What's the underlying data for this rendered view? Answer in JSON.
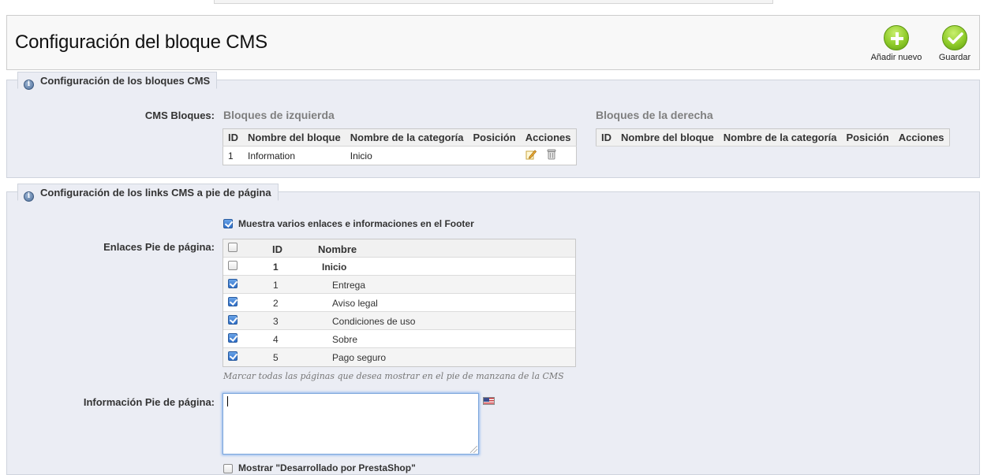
{
  "toolbar": {
    "title": "Configuración del bloque CMS",
    "add_label": "Añadir nuevo",
    "save_label": "Guardar",
    "accent": "#8fcb2a"
  },
  "cms_blocks": {
    "legend": "Configuración de los bloques CMS",
    "label": "CMS Bloques:",
    "left": {
      "heading": "Bloques de izquierda",
      "columns": [
        "ID",
        "Nombre del bloque",
        "Nombre de la categoría",
        "Posición",
        "Acciones"
      ],
      "rows": [
        {
          "id": "1",
          "name": "Information",
          "category": "Inicio",
          "position": ""
        }
      ]
    },
    "right": {
      "heading": "Bloques de la derecha",
      "columns": [
        "ID",
        "Nombre del bloque",
        "Nombre de la categoría",
        "Posición",
        "Acciones"
      ],
      "rows": []
    }
  },
  "footer": {
    "legend": "Configuración de los links CMS a pie de página",
    "show_footer_label": "Muestra varios enlaces e informaciones en el Footer",
    "show_footer_checked": true,
    "links_label": "Enlaces Pie de página:",
    "links_columns": [
      "ID",
      "Nombre"
    ],
    "links": [
      {
        "id": "1",
        "name": "Inicio",
        "checked": false,
        "parent": true
      },
      {
        "id": "1",
        "name": "Entrega",
        "checked": true,
        "parent": false
      },
      {
        "id": "2",
        "name": "Aviso legal",
        "checked": true,
        "parent": false
      },
      {
        "id": "3",
        "name": "Condiciones de uso",
        "checked": true,
        "parent": false
      },
      {
        "id": "4",
        "name": "Sobre",
        "checked": true,
        "parent": false
      },
      {
        "id": "5",
        "name": "Pago seguro",
        "checked": true,
        "parent": false
      }
    ],
    "hint": "Marcar todas las páginas que desea mostrar en el pie de manzana de la CMS",
    "info_label": "Información Pie de página:",
    "info_value": "",
    "powered_label": "Mostrar \"Desarrollado por PrestaShop\"",
    "powered_checked": false
  }
}
